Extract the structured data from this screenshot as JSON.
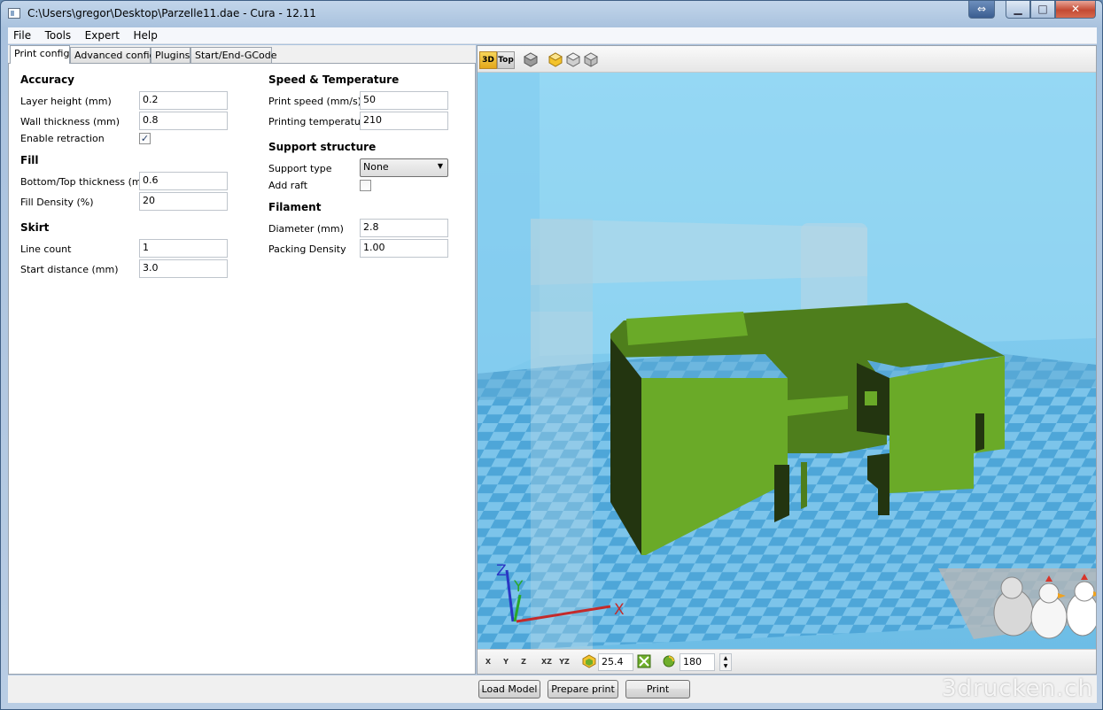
{
  "window": {
    "title": "C:\\Users\\gregor\\Desktop\\Parzelle11.dae - Cura - 12.11",
    "buttons": {
      "restore_extra": "⇔",
      "minimize": "▁",
      "maximize": "□",
      "close": "✕"
    }
  },
  "menu": [
    "File",
    "Tools",
    "Expert",
    "Help"
  ],
  "tabs": [
    "Print config",
    "Advanced config",
    "Plugins",
    "Start/End-GCode"
  ],
  "accuracy": {
    "title": "Accuracy",
    "layer_height_label": "Layer height (mm)",
    "layer_height": "0.2",
    "wall_thickness_label": "Wall thickness (mm)",
    "wall_thickness": "0.8",
    "retraction_label": "Enable retraction",
    "retraction_checked": "✓"
  },
  "fill": {
    "title": "Fill",
    "bottom_top_label": "Bottom/Top thickness (mm)",
    "bottom_top": "0.6",
    "density_label": "Fill Density (%)",
    "density": "20"
  },
  "skirt": {
    "title": "Skirt",
    "line_count_label": "Line count",
    "line_count": "1",
    "start_distance_label": "Start distance (mm)",
    "start_distance": "3.0"
  },
  "speed": {
    "title": "Speed & Temperature",
    "print_speed_label": "Print speed (mm/s)",
    "print_speed": "50",
    "temperature_label": "Printing temperature",
    "temperature": "210"
  },
  "support": {
    "title": "Support structure",
    "type_label": "Support type",
    "type_value": "None",
    "raft_label": "Add raft",
    "raft_checked": ""
  },
  "filament": {
    "title": "Filament",
    "diameter_label": "Diameter (mm)",
    "diameter": "2.8",
    "packing_label": "Packing Density",
    "packing": "1.00"
  },
  "view_toolbar": {
    "view_3d": "3D",
    "view_top": "Top"
  },
  "viewport": {
    "axis_z": "Z",
    "axis_y": "Y",
    "axis_x": "X",
    "colors": {
      "sky": "#78c8ec",
      "model": "#6aaa28",
      "model_top": "#4e7e1c",
      "model_dark": "#233510"
    }
  },
  "bottom_toolbar": {
    "mirror_x": "X",
    "mirror_y": "Y",
    "mirror_z": "Z",
    "swap_xz": "XZ",
    "swap_yz": "YZ",
    "scale": "25.4",
    "rotate": "180"
  },
  "buttons": {
    "load_model": "Load Model",
    "prepare_print": "Prepare print",
    "print": "Print"
  },
  "watermark": "3drucken.ch"
}
